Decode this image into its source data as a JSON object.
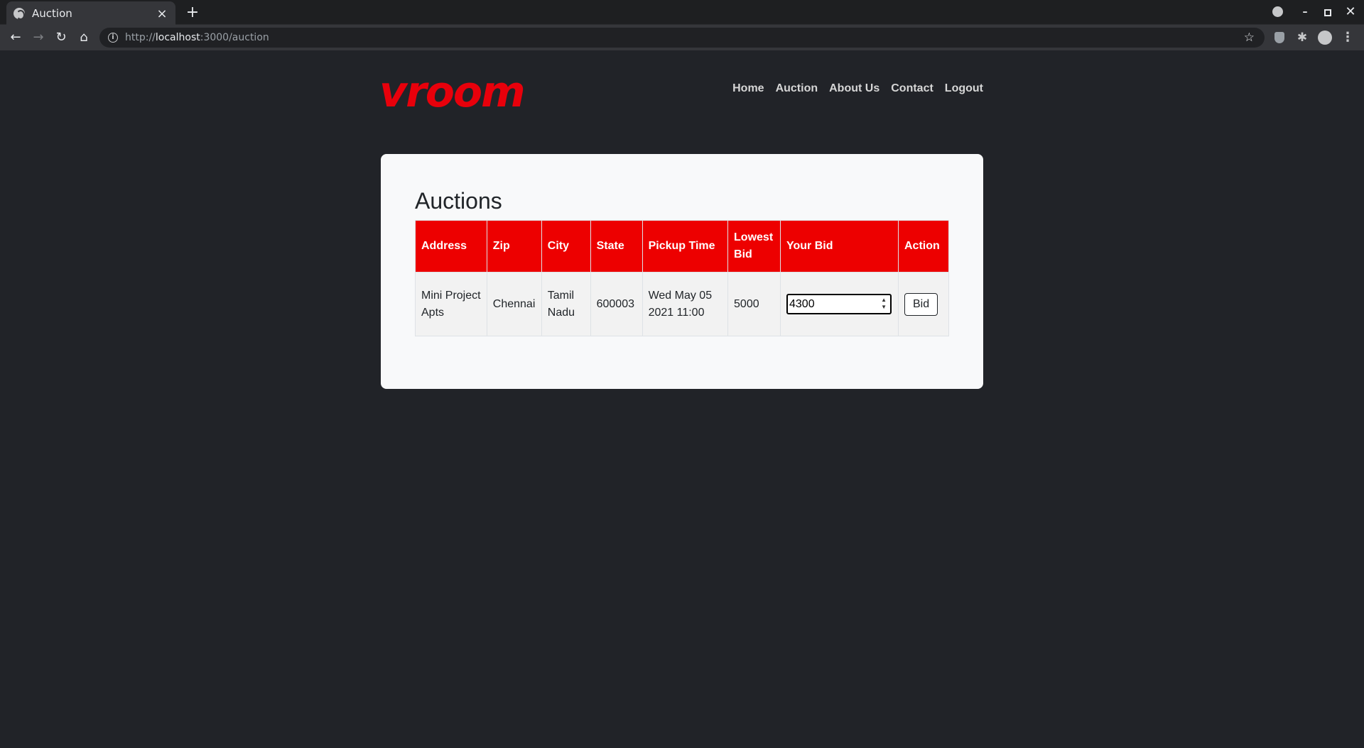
{
  "browser": {
    "tab_title": "Auction",
    "new_tab": "+",
    "close": "×",
    "url_scheme": "http://",
    "url_host": "localhost",
    "url_path": ":3000/auction"
  },
  "site": {
    "logo": "vroom",
    "nav": [
      "Home",
      "Auction",
      "About Us",
      "Contact",
      "Logout"
    ]
  },
  "auctions": {
    "heading": "Auctions",
    "columns": [
      "Address",
      "Zip",
      "City",
      "State",
      "Pickup Time",
      "Lowest Bid",
      "Your Bid",
      "Action"
    ],
    "rows": [
      {
        "address": "Mini Project Apts",
        "zip": "Chennai",
        "city": "Tamil Nadu",
        "state": "600003",
        "pickup_time": "Wed May 05 2021 11:00",
        "lowest_bid": "5000",
        "your_bid": "4300",
        "action": "Bid"
      }
    ]
  },
  "colors": {
    "brand_red": "#ed0000",
    "background": "#212328",
    "card": "#f8f9fa"
  }
}
